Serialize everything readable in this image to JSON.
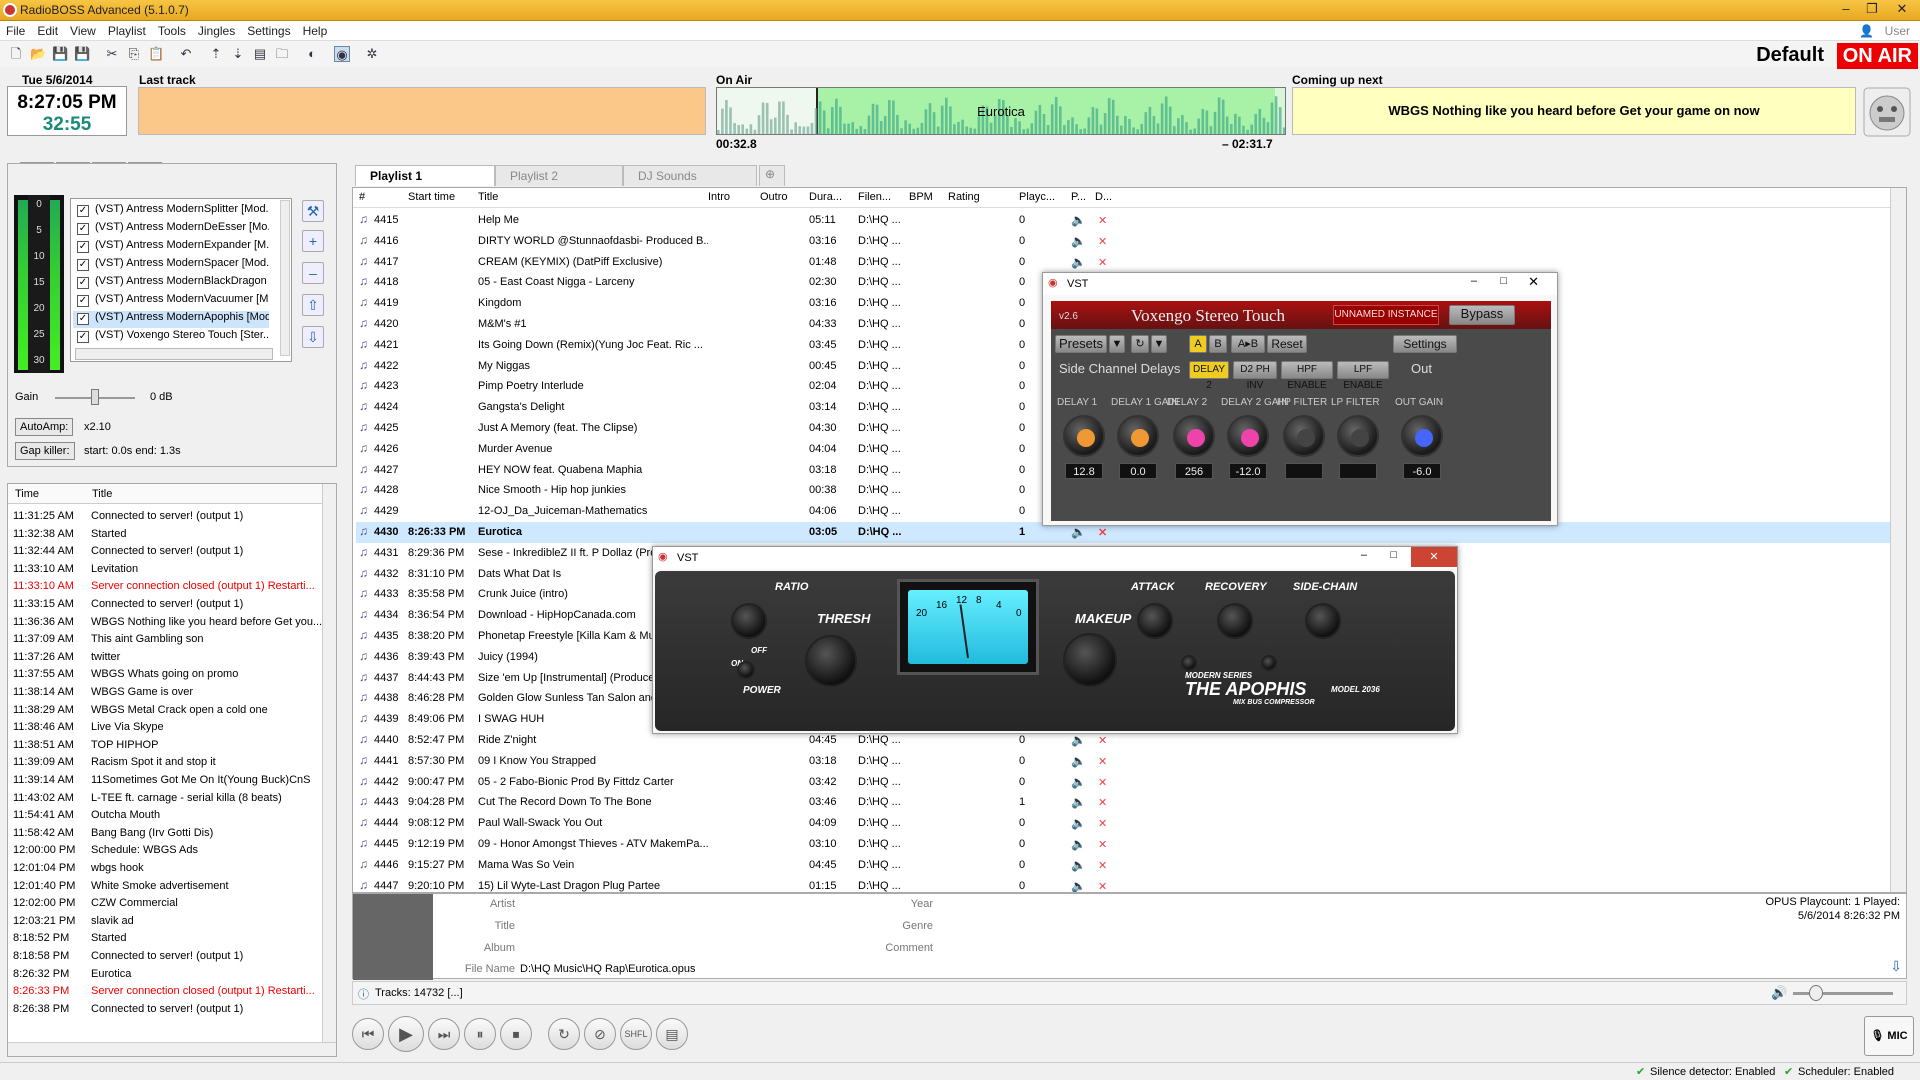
{
  "app": {
    "title": "RadioBOSS Advanced (5.1.0.7)",
    "user_label": "User"
  },
  "menu": [
    "File",
    "Edit",
    "View",
    "Playlist",
    "Tools",
    "Jingles",
    "Settings",
    "Help"
  ],
  "header": {
    "profile": "Default",
    "onair": "ON AIR"
  },
  "clock": {
    "date": "Tue 5/6/2014",
    "time": "8:27:05 PM",
    "countdown": "32:55"
  },
  "last_track": {
    "label": "Last track"
  },
  "on_air": {
    "label": "On Air",
    "title": "Eurotica",
    "elapsed": "00:32.8",
    "remaining": "– 02:31.7"
  },
  "coming_up": {
    "label": "Coming up next",
    "text": "WBGS Nothing like you heard before Get your game on now"
  },
  "effects": {
    "items": [
      "(VST) Antress ModernSplitter [Mod...",
      "(VST) Antress ModernDeEsser [Mo...",
      "(VST) Antress ModernExpander [M...",
      "(VST) Antress ModernSpacer [Mod...",
      "(VST) Antress ModernBlackDragon ...",
      "(VST) Antress ModernVacuumer [M...",
      "(VST) Antress ModernApophis [Mod...",
      "(VST) Voxengo Stereo Touch [Ster..."
    ],
    "meter_scale": [
      "0",
      "5",
      "10",
      "15",
      "20",
      "25",
      "30"
    ],
    "gain_label": "Gain",
    "gain_value": "0 dB",
    "autoamp_label": "AutoAmp:",
    "autoamp_value": "x2.10",
    "gapkiller_label": "Gap killer:",
    "gapkiller_value": "start: 0.0s end: 1.3s"
  },
  "log": {
    "headers": [
      "Time",
      "Title"
    ],
    "rows": [
      {
        "time": "11:31:25 AM",
        "msg": "Connected to server! (output 1)",
        "error": false
      },
      {
        "time": "11:32:38 AM",
        "msg": "Started",
        "error": false
      },
      {
        "time": "11:32:44 AM",
        "msg": "Connected to server! (output 1)",
        "error": false
      },
      {
        "time": "11:33:10 AM",
        "msg": "Levitation",
        "error": false
      },
      {
        "time": "11:33:10 AM",
        "msg": "Server connection closed (output 1) Restarti...",
        "error": true
      },
      {
        "time": "11:33:15 AM",
        "msg": "Connected to server! (output 1)",
        "error": false
      },
      {
        "time": "11:36:36 AM",
        "msg": "WBGS Nothing like you heard before Get you...",
        "error": false
      },
      {
        "time": "11:37:09 AM",
        "msg": "This aint Gambling son",
        "error": false
      },
      {
        "time": "11:37:26 AM",
        "msg": "twitter",
        "error": false
      },
      {
        "time": "11:37:55 AM",
        "msg": "WBGS Whats going on promo",
        "error": false
      },
      {
        "time": "11:38:14 AM",
        "msg": "WBGS Game is over",
        "error": false
      },
      {
        "time": "11:38:29 AM",
        "msg": "WBGS Metal Crack open a cold one",
        "error": false
      },
      {
        "time": "11:38:46 AM",
        "msg": "Live Via Skype",
        "error": false
      },
      {
        "time": "11:38:51 AM",
        "msg": "TOP HIPHOP",
        "error": false
      },
      {
        "time": "11:39:09 AM",
        "msg": "Racism Spot it and stop it",
        "error": false
      },
      {
        "time": "11:39:14 AM",
        "msg": "11Sometimes Got Me On It(Young Buck)CnS",
        "error": false
      },
      {
        "time": "11:43:02 AM",
        "msg": "L-TEE ft. carnage - serial killa (8 beats)",
        "error": false
      },
      {
        "time": "11:54:41 AM",
        "msg": "Outcha Mouth",
        "error": false
      },
      {
        "time": "11:58:42 AM",
        "msg": "Bang Bang (Irv Gotti Dis)",
        "error": false
      },
      {
        "time": "12:00:00 PM",
        "msg": "Schedule: WBGS Ads",
        "error": false
      },
      {
        "time": "12:01:04 PM",
        "msg": "wbgs hook",
        "error": false
      },
      {
        "time": "12:01:40 PM",
        "msg": "White Smoke advertisement",
        "error": false
      },
      {
        "time": "12:02:00 PM",
        "msg": "CZW Commercial",
        "error": false
      },
      {
        "time": "12:03:21 PM",
        "msg": "slavik ad",
        "error": false
      },
      {
        "time": "8:18:52 PM",
        "msg": "Started",
        "error": false
      },
      {
        "time": "8:18:58 PM",
        "msg": "Connected to server! (output 1)",
        "error": false
      },
      {
        "time": "8:26:32 PM",
        "msg": "Eurotica",
        "error": false
      },
      {
        "time": "8:26:33 PM",
        "msg": "Server connection closed (output 1) Restarti...",
        "error": true
      },
      {
        "time": "8:26:38 PM",
        "msg": "Connected to server! (output 1)",
        "error": false
      }
    ]
  },
  "playlist": {
    "tabs": [
      "Playlist 1",
      "Playlist 2",
      "DJ Sounds"
    ],
    "headers": [
      "#",
      "Start time",
      "Title",
      "Intro",
      "Outro",
      "Dura...",
      "Filen...",
      "BPM",
      "Rating",
      "Playc...",
      "P...",
      "D..."
    ],
    "rows": [
      {
        "num": "4415",
        "start": "",
        "title": "Help Me",
        "dur": "05:11",
        "file": "D:\\HQ ...",
        "plays": "0"
      },
      {
        "num": "4416",
        "start": "",
        "title": "DIRTY WORLD @Stunnaofdasbi- Produced B...",
        "dur": "03:16",
        "file": "D:\\HQ ...",
        "plays": "0"
      },
      {
        "num": "4417",
        "start": "",
        "title": "CREAM (KEYMIX) (DatPiff Exclusive)",
        "dur": "01:48",
        "file": "D:\\HQ ...",
        "plays": "0"
      },
      {
        "num": "4418",
        "start": "",
        "title": "05 - East Coast Nigga - Larceny",
        "dur": "02:30",
        "file": "D:\\HQ ...",
        "plays": "0"
      },
      {
        "num": "4419",
        "start": "",
        "title": "Kingdom",
        "dur": "03:16",
        "file": "D:\\HQ ...",
        "plays": "0"
      },
      {
        "num": "4420",
        "start": "",
        "title": "M&M's #1",
        "dur": "04:33",
        "file": "D:\\HQ ...",
        "plays": "0"
      },
      {
        "num": "4421",
        "start": "",
        "title": "Its Going Down (Remix)(Yung Joc Feat. Ric ...",
        "dur": "03:45",
        "file": "D:\\HQ ...",
        "plays": "0"
      },
      {
        "num": "4422",
        "start": "",
        "title": "My Niggas",
        "dur": "00:45",
        "file": "D:\\HQ ...",
        "plays": "0"
      },
      {
        "num": "4423",
        "start": "",
        "title": "Pimp Poetry Interlude",
        "dur": "02:04",
        "file": "D:\\HQ ...",
        "plays": "0"
      },
      {
        "num": "4424",
        "start": "",
        "title": "Gangsta's Delight",
        "dur": "03:14",
        "file": "D:\\HQ ...",
        "plays": "0"
      },
      {
        "num": "4425",
        "start": "",
        "title": "Just A Memory (feat. The Clipse)",
        "dur": "04:30",
        "file": "D:\\HQ ...",
        "plays": "0"
      },
      {
        "num": "4426",
        "start": "",
        "title": "Murder Avenue",
        "dur": "04:04",
        "file": "D:\\HQ ...",
        "plays": "0"
      },
      {
        "num": "4427",
        "start": "",
        "title": "HEY NOW feat. Quabena Maphia",
        "dur": "03:18",
        "file": "D:\\HQ ...",
        "plays": "0"
      },
      {
        "num": "4428",
        "start": "",
        "title": "Nice  Smooth - Hip hop junkies",
        "dur": "00:38",
        "file": "D:\\HQ ...",
        "plays": "0"
      },
      {
        "num": "4429",
        "start": "",
        "title": "12-OJ_Da_Juiceman-Mathematics",
        "dur": "04:06",
        "file": "D:\\HQ ...",
        "plays": "0"
      },
      {
        "num": "4430",
        "start": "8:26:33 PM",
        "title": "Eurotica",
        "dur": "03:05",
        "file": "D:\\HQ ...",
        "plays": "1"
      },
      {
        "num": "4431",
        "start": "8:29:36 PM",
        "title": "Sese - InkredibleZ II ft. P Dollaz (Pro",
        "dur": "",
        "file": "",
        "plays": ""
      },
      {
        "num": "4432",
        "start": "8:31:10 PM",
        "title": "Dats What Dat Is",
        "dur": "",
        "file": "",
        "plays": ""
      },
      {
        "num": "4433",
        "start": "8:35:58 PM",
        "title": "Crunk Juice (intro)",
        "dur": "",
        "file": "",
        "plays": ""
      },
      {
        "num": "4434",
        "start": "8:36:54 PM",
        "title": "Download - HipHopCanada.com",
        "dur": "",
        "file": "",
        "plays": ""
      },
      {
        "num": "4435",
        "start": "8:38:20 PM",
        "title": "Phonetap Freestyle [Killa Kam & Mur",
        "dur": "",
        "file": "",
        "plays": ""
      },
      {
        "num": "4436",
        "start": "8:39:43 PM",
        "title": "Juicy (1994)",
        "dur": "",
        "file": "",
        "plays": ""
      },
      {
        "num": "4437",
        "start": "8:44:43 PM",
        "title": "Size 'em Up [Instrumental] (Produce",
        "dur": "",
        "file": "",
        "plays": ""
      },
      {
        "num": "4438",
        "start": "8:46:28 PM",
        "title": "Golden Glow Sunless Tan Salon and S",
        "dur": "",
        "file": "",
        "plays": ""
      },
      {
        "num": "4439",
        "start": "8:49:06 PM",
        "title": "I SWAG HUH",
        "dur": "",
        "file": "",
        "plays": ""
      },
      {
        "num": "4440",
        "start": "8:52:47 PM",
        "title": "Ride Z'night",
        "dur": "04:45",
        "file": "D:\\HQ ...",
        "plays": "0"
      },
      {
        "num": "4441",
        "start": "8:57:30 PM",
        "title": "09 I Know You Strapped",
        "dur": "03:18",
        "file": "D:\\HQ ...",
        "plays": "0"
      },
      {
        "num": "4442",
        "start": "9:00:47 PM",
        "title": "05 - 2 Fabo-Bionic Prod By Fittdz Carter",
        "dur": "03:42",
        "file": "D:\\HQ ...",
        "plays": "0"
      },
      {
        "num": "4443",
        "start": "9:04:28 PM",
        "title": "Cut The Record Down To The Bone",
        "dur": "03:46",
        "file": "D:\\HQ ...",
        "plays": "1"
      },
      {
        "num": "4444",
        "start": "9:08:12 PM",
        "title": "Paul Wall-Swack You Out",
        "dur": "04:09",
        "file": "D:\\HQ ...",
        "plays": "0"
      },
      {
        "num": "4445",
        "start": "9:12:19 PM",
        "title": "09 - Honor Amongst Thieves - ATV MakemPa...",
        "dur": "03:10",
        "file": "D:\\HQ ...",
        "plays": "0"
      },
      {
        "num": "4446",
        "start": "9:15:27 PM",
        "title": "Mama Was So Vein",
        "dur": "04:45",
        "file": "D:\\HQ ...",
        "plays": "0"
      },
      {
        "num": "4447",
        "start": "9:20:10 PM",
        "title": "15) Lil Wyte-Last Dragon Plug Partee",
        "dur": "01:15",
        "file": "D:\\HQ ...",
        "plays": "0"
      }
    ]
  },
  "info": {
    "artist_label": "Artist",
    "title_label": "Title",
    "album_label": "Album",
    "filename_label": "File Name",
    "filename": "D:\\HQ Music\\HQ Rap\\Eurotica.opus",
    "year_label": "Year",
    "genre_label": "Genre",
    "comment_label": "Comment",
    "stats_line1": "OPUS Playcount: 1  Played:",
    "stats_line2": "5/6/2014 8:26:32 PM"
  },
  "tracks": {
    "text": "Tracks: 14732 [...]"
  },
  "mic": {
    "label": "MIC"
  },
  "status": {
    "silence": "Silence detector: Enabled",
    "scheduler": "Scheduler: Enabled"
  },
  "vst1": {
    "window_title": "VST",
    "version": "v2.6",
    "name": "Voxengo Stereo Touch",
    "instance": "UNNAMED INSTANCE",
    "bypass": "Bypass",
    "presets": "Presets",
    "a": "A",
    "b": "B",
    "ab": "A▸B",
    "reset": "Reset",
    "settings": "Settings",
    "section": "Side Channel Delays",
    "out": "Out",
    "toggles": [
      "DELAY 2",
      "D2 PH INV",
      "HPF ENABLE",
      "LPF ENABLE"
    ],
    "knob_labels": [
      "DELAY 1",
      "DELAY 1 GAIN",
      "DELAY 2",
      "DELAY 2 GAIN",
      "HP FILTER",
      "LP FILTER",
      "OUT GAIN"
    ],
    "knob_values": [
      "12.8",
      "0.0",
      "256",
      "-12.0",
      "",
      "",
      "-6.0"
    ]
  },
  "vst2": {
    "window_title": "VST",
    "labels": {
      "ratio": "RATIO",
      "thresh": "THRESH",
      "makeup": "MAKEUP",
      "attack": "ATTACK",
      "recovery": "RECOVERY",
      "sidechain": "SIDE-CHAIN",
      "power": "POWER",
      "on": "ON",
      "off": "OFF",
      "series": "MODERN SERIES",
      "name": "THE APOPHIS",
      "model": "MODEL 2036",
      "sub": "MIX BUS COMPRESSOR"
    },
    "meter_scale": [
      "20",
      "16",
      "12",
      "8",
      "4",
      "0"
    ]
  }
}
